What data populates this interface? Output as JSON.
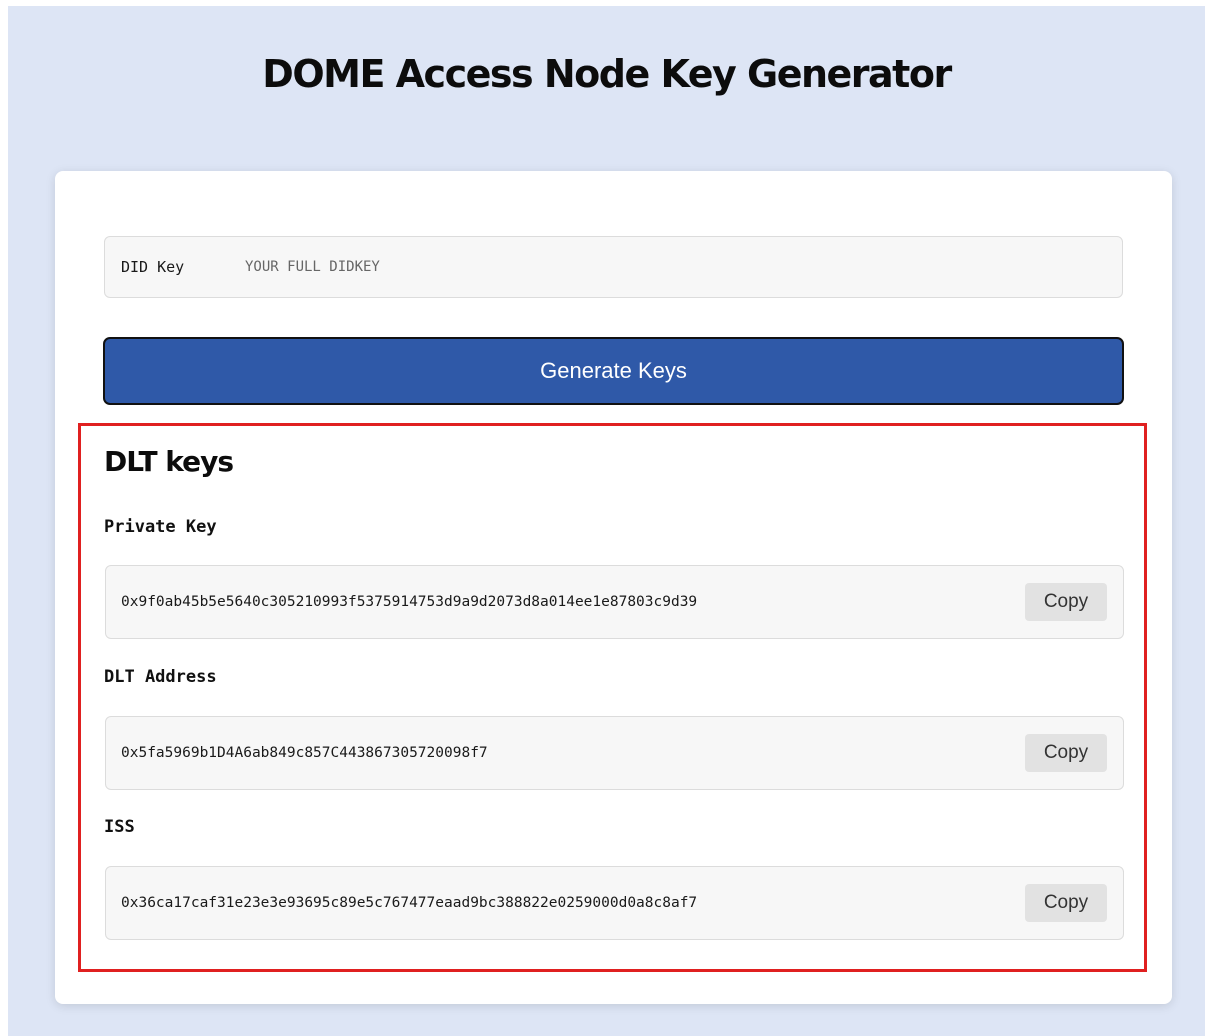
{
  "page": {
    "title": "DOME Access Node Key Generator"
  },
  "did_field": {
    "label": "DID Key",
    "value": "",
    "placeholder": "YOUR FULL DIDKEY"
  },
  "generate_button": {
    "label": "Generate Keys"
  },
  "results": {
    "title": "DLT keys",
    "keys": [
      {
        "label": "Private Key",
        "value": "0x9f0ab45b5e5640c305210993f5375914753d9a9d2073d8a014ee1e87803c9d39",
        "copy_label": "Copy"
      },
      {
        "label": "DLT Address",
        "value": "0x5fa5969b1D4A6ab849c857C443867305720098f7",
        "copy_label": "Copy"
      },
      {
        "label": "ISS",
        "value": "0x36ca17caf31e23e3e93695c89e5c767477eaad9bc388822e0259000d0a8c8af7",
        "copy_label": "Copy"
      }
    ]
  },
  "colors": {
    "background": "#dde5f5",
    "card": "#ffffff",
    "primary_button": "#2f59a8",
    "highlight_border": "#e02020",
    "field_background": "#f7f7f7",
    "copy_button": "#e2e2e2"
  }
}
